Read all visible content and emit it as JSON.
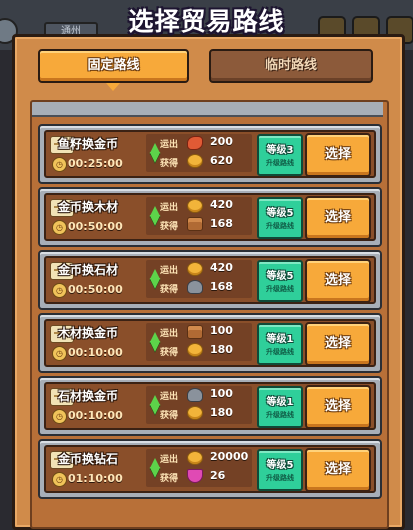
{
  "title": "选择贸易路线",
  "background": {
    "tab_label": "通州"
  },
  "tabs": {
    "active": "固定路线",
    "inactive": "临时路线"
  },
  "labels": {
    "ship_out": "运出",
    "receive": "获得",
    "upgrade_route": "升级路线",
    "select": "选择"
  },
  "routes": [
    {
      "name": "鱼籽换金币",
      "time": "00:25:00",
      "out_icon": "fish-roe-icon",
      "out_amount": "200",
      "in_icon": "gold-coin-icon",
      "in_amount": "620",
      "level": "等级3"
    },
    {
      "name": "金币换木材",
      "time": "00:50:00",
      "out_icon": "gold-coin-icon",
      "out_amount": "420",
      "in_icon": "wood-icon",
      "in_amount": "168",
      "level": "等级5"
    },
    {
      "name": "金币换石材",
      "time": "00:50:00",
      "out_icon": "gold-coin-icon",
      "out_amount": "420",
      "in_icon": "stone-icon",
      "in_amount": "168",
      "level": "等级5"
    },
    {
      "name": "木材换金币",
      "time": "00:10:00",
      "out_icon": "wood-icon",
      "out_amount": "100",
      "in_icon": "gold-coin-icon",
      "in_amount": "180",
      "level": "等级1"
    },
    {
      "name": "石材换金币",
      "time": "00:10:00",
      "out_icon": "stone-icon",
      "out_amount": "100",
      "in_icon": "gold-coin-icon",
      "in_amount": "180",
      "level": "等级1"
    },
    {
      "name": "金币换钻石",
      "time": "01:10:00",
      "out_icon": "gold-coin-icon",
      "out_amount": "20000",
      "in_icon": "diamond-icon",
      "in_amount": "26",
      "level": "等级5"
    }
  ]
}
